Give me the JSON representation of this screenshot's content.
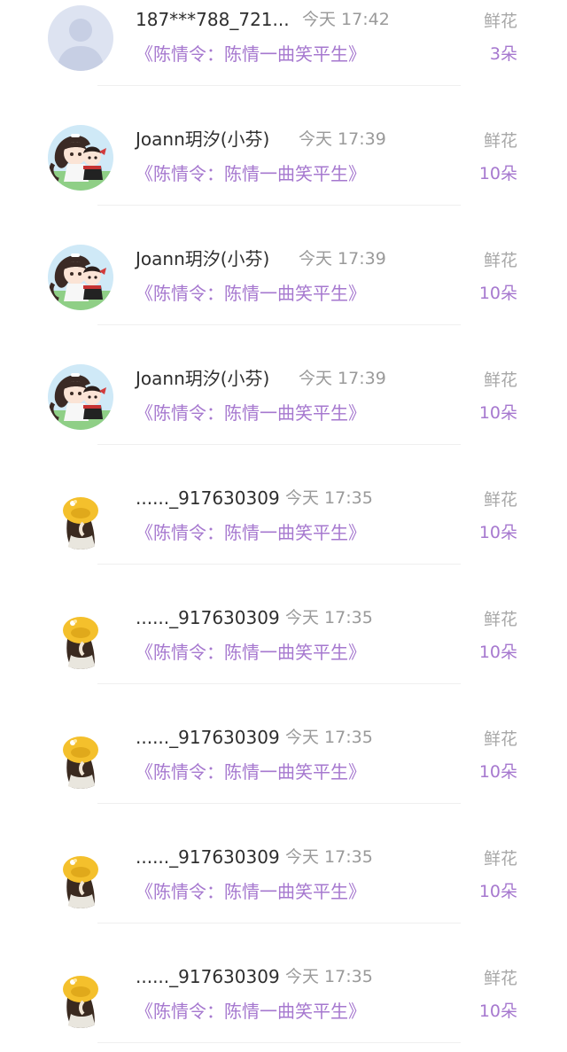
{
  "records": [
    {
      "username": "187***788_721...",
      "time": "今天 17:42",
      "book": "《陈情令：陈情一曲笑平生》",
      "gift": "鲜花",
      "count": "3朵",
      "avatar": "default-person-avatar"
    },
    {
      "username": "Joann玥汐(小芬)",
      "time": "今天 17:39",
      "book": "《陈情令：陈情一曲笑平生》",
      "gift": "鲜花",
      "count": "10朵",
      "avatar": "anime-chibi-avatar"
    },
    {
      "username": "Joann玥汐(小芬)",
      "time": "今天 17:39",
      "book": "《陈情令：陈情一曲笑平生》",
      "gift": "鲜花",
      "count": "10朵",
      "avatar": "anime-chibi-avatar"
    },
    {
      "username": "Joann玥汐(小芬)",
      "time": "今天 17:39",
      "book": "《陈情令：陈情一曲笑平生》",
      "gift": "鲜花",
      "count": "10朵",
      "avatar": "anime-chibi-avatar"
    },
    {
      "username": "......_917630309",
      "time": "今天 17:35",
      "book": "《陈情令：陈情一曲笑平生》",
      "gift": "鲜花",
      "count": "10朵",
      "avatar": "yellow-hat-girl-avatar"
    },
    {
      "username": "......_917630309",
      "time": "今天 17:35",
      "book": "《陈情令：陈情一曲笑平生》",
      "gift": "鲜花",
      "count": "10朵",
      "avatar": "yellow-hat-girl-avatar"
    },
    {
      "username": "......_917630309",
      "time": "今天 17:35",
      "book": "《陈情令：陈情一曲笑平生》",
      "gift": "鲜花",
      "count": "10朵",
      "avatar": "yellow-hat-girl-avatar"
    },
    {
      "username": "......_917630309",
      "time": "今天 17:35",
      "book": "《陈情令：陈情一曲笑平生》",
      "gift": "鲜花",
      "count": "10朵",
      "avatar": "yellow-hat-girl-avatar"
    },
    {
      "username": "......_917630309",
      "time": "今天 17:35",
      "book": "《陈情令：陈情一曲笑平生》",
      "gift": "鲜花",
      "count": "10朵",
      "avatar": "yellow-hat-girl-avatar"
    }
  ],
  "colors": {
    "accent_purple": "#a678cf",
    "username_text": "#2e2e2e",
    "muted_text": "#9a9a9a"
  }
}
